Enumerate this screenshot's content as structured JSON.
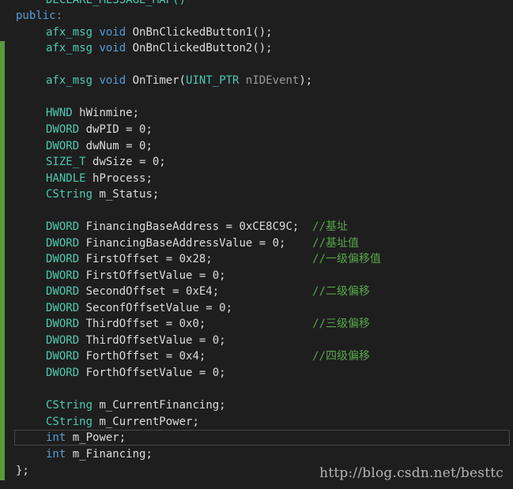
{
  "code": {
    "line_top": "DECLARE_MESSAGE_MAP()",
    "public_label": "public:",
    "m1_kw": "afx_msg",
    "m1_void": "void",
    "m1_name": "OnBnClickedButton1();",
    "m2_kw": "afx_msg",
    "m2_void": "void",
    "m2_name": "OnBnClickedButton2();",
    "m3_kw": "afx_msg",
    "m3_void": "void",
    "m3_name": "OnTimer(",
    "m3_type": "UINT_PTR",
    "m3_param": "nIDEvent",
    "m3_end": ");",
    "v1_type": "HWND",
    "v1_rest": "hWinmine;",
    "v2_type": "DWORD",
    "v2_rest": "dwPID = 0;",
    "v3_type": "DWORD",
    "v3_rest": "dwNum = 0;",
    "v4_type": "SIZE_T",
    "v4_rest": "dwSize = 0;",
    "v5_type": "HANDLE",
    "v5_rest": "hProcess;",
    "v6_type": "CString",
    "v6_rest": "m_Status;",
    "f1_type": "DWORD",
    "f1_rest": "FinancingBaseAddress = 0xCE8C9C;  ",
    "f1_cm": "//基址",
    "f2_type": "DWORD",
    "f2_rest": "FinancingBaseAddressValue = 0;    ",
    "f2_cm": "//基址值",
    "f3_type": "DWORD",
    "f3_rest": "FirstOffset = 0x28;               ",
    "f3_cm": "//一级偏移值",
    "f4_type": "DWORD",
    "f4_rest": "FirstOffsetValue = 0;",
    "f5_type": "DWORD",
    "f5_rest": "SecondOffset = 0xE4;              ",
    "f5_cm": "//二级偏移",
    "f6_type": "DWORD",
    "f6_rest": "SeconfOffsetValue = 0;",
    "f7_type": "DWORD",
    "f7_rest": "ThirdOffset = 0x0;                ",
    "f7_cm": "//三级偏移",
    "f8_type": "DWORD",
    "f8_rest": "ThirdOffsetValue = 0;",
    "f9_type": "DWORD",
    "f9_rest": "ForthOffset = 0x4;                ",
    "f9_cm": "//四级偏移",
    "f10_type": "DWORD",
    "f10_rest": "ForthOffsetValue = 0;",
    "c1_type": "CString",
    "c1_rest": "m_CurrentFinancing;",
    "c2_type": "CString",
    "c2_rest": "m_CurrentPower;",
    "i1_type": "int",
    "i1_rest": "m_Power;",
    "i2_type": "int",
    "i2_rest": "m_Financing;",
    "closing": "};"
  },
  "watermark": "http://blog.csdn.net/besttc",
  "colors": {
    "background": "#1e1e1e",
    "keyword": "#569cd6",
    "type": "#4ec9b0",
    "comment": "#57a64a",
    "text": "#dcdcdc",
    "change_bar": "#579b3a"
  }
}
